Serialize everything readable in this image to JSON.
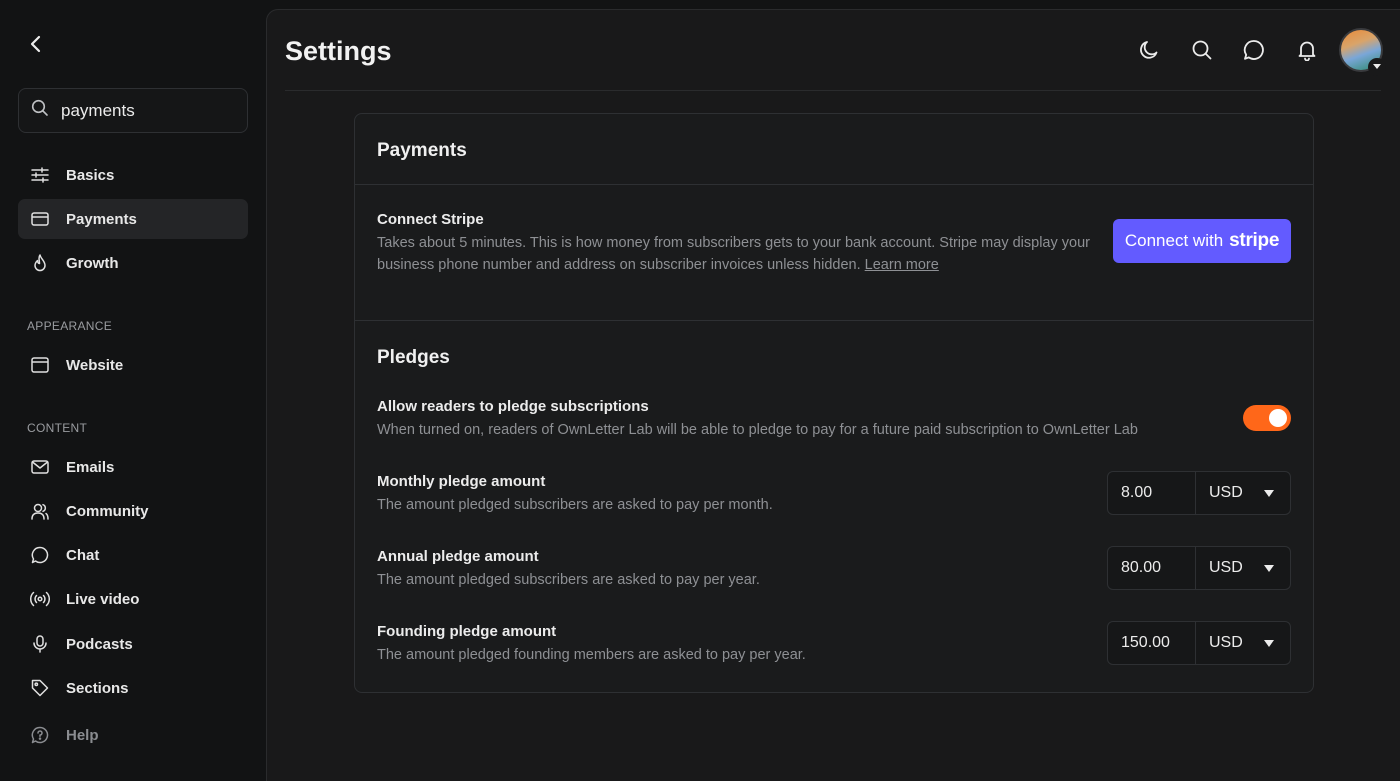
{
  "sidebar": {
    "search": {
      "value": "payments",
      "placeholder": "Search"
    },
    "items": [
      {
        "label": "Basics"
      },
      {
        "label": "Payments"
      },
      {
        "label": "Growth"
      }
    ],
    "appearance_heading": "APPEARANCE",
    "appearance_items": [
      {
        "label": "Website"
      }
    ],
    "content_heading": "CONTENT",
    "content_items": [
      {
        "label": "Emails"
      },
      {
        "label": "Community"
      },
      {
        "label": "Chat"
      },
      {
        "label": "Live video"
      },
      {
        "label": "Podcasts"
      },
      {
        "label": "Sections"
      }
    ],
    "help_label": "Help"
  },
  "header": {
    "title": "Settings"
  },
  "payments": {
    "title": "Payments",
    "stripe": {
      "title": "Connect Stripe",
      "desc_line1": "Takes about 5 minutes. This is how money from subscribers gets to your bank account. Stripe may display your",
      "desc_line2": "business phone number and address on subscriber invoices unless hidden.",
      "learn_more": "Learn more",
      "button_prefix": "Connect with",
      "button_brand": "stripe"
    }
  },
  "pledges": {
    "title": "Pledges",
    "allow": {
      "title": "Allow readers to pledge subscriptions",
      "desc": "When turned on, readers of OwnLetter Lab will be able to pledge to pay for a future paid subscription to OwnLetter Lab",
      "enabled": true
    },
    "monthly": {
      "title": "Monthly pledge amount",
      "desc": "The amount pledged subscribers are asked to pay per month.",
      "value": "8.00",
      "currency": "USD"
    },
    "annual": {
      "title": "Annual pledge amount",
      "desc": "The amount pledged subscribers are asked to pay per year.",
      "value": "80.00",
      "currency": "USD"
    },
    "founding": {
      "title": "Founding pledge amount",
      "desc": "The amount pledged founding members are asked to pay per year.",
      "value": "150.00",
      "currency": "USD"
    }
  },
  "colors": {
    "accent": "#ff6719",
    "stripe": "#635bff"
  }
}
